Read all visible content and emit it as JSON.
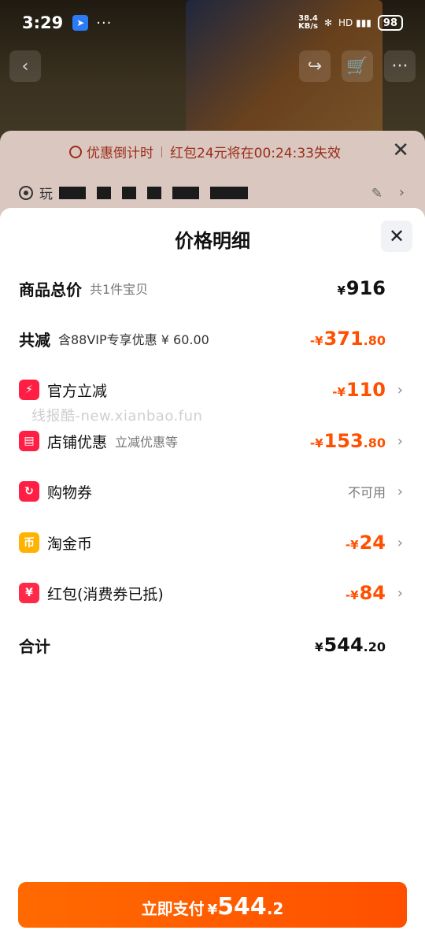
{
  "status_bar": {
    "time": "3:29",
    "dots": "···",
    "speed_value": "38.4",
    "speed_unit": "KB/s",
    "bluetooth": "✻",
    "signal": "HD ▮▮▮",
    "battery": "98"
  },
  "promo": {
    "countdown_label": "优惠倒计时",
    "countdown_text": "红包24元将在00:24:33失效",
    "address_prefix": "玩"
  },
  "sheet": {
    "title": "价格明细",
    "watermark": "线报酷-new.xianbao.fun",
    "rows": {
      "total_price": {
        "label": "商品总价",
        "sub": "共1件宝贝",
        "cur": "¥",
        "int": "916",
        "dec": ""
      },
      "discount_total": {
        "label": "共减",
        "sub": "含88VIP专享优惠 ¥ 60.00",
        "prefix": "-¥",
        "int": "371",
        "dec": ".80"
      },
      "official": {
        "label": "官方立减",
        "prefix": "-¥",
        "int": "110",
        "dec": ""
      },
      "store": {
        "label": "店铺优惠",
        "sub": "立减优惠等",
        "prefix": "-¥",
        "int": "153",
        "dec": ".80"
      },
      "coupon": {
        "label": "购物券",
        "status": "不可用"
      },
      "gold_coin": {
        "label": "淘金币",
        "prefix": "-¥",
        "int": "24",
        "dec": ""
      },
      "red_packet": {
        "label": "红包(消费券已抵)",
        "prefix": "-¥",
        "int": "84",
        "dec": ""
      },
      "total": {
        "label": "合计",
        "cur": "¥",
        "int": "544",
        "dec": ".20"
      }
    },
    "pay_button": {
      "label": "立即支付",
      "cur": "¥",
      "int": "544",
      "dec": ".2"
    }
  },
  "colors": {
    "accent": "#ff5000",
    "icon_red": "#ff1f44",
    "icon_gold": "#ffb300"
  },
  "icons": [
    "back-arrow-icon",
    "share-icon",
    "cart-icon",
    "clock-icon",
    "close-icon",
    "location-pin-icon",
    "edit-icon",
    "chevron-right-icon",
    "lightning-icon",
    "store-icon",
    "coupon-icon",
    "coin-icon",
    "red-packet-icon"
  ]
}
